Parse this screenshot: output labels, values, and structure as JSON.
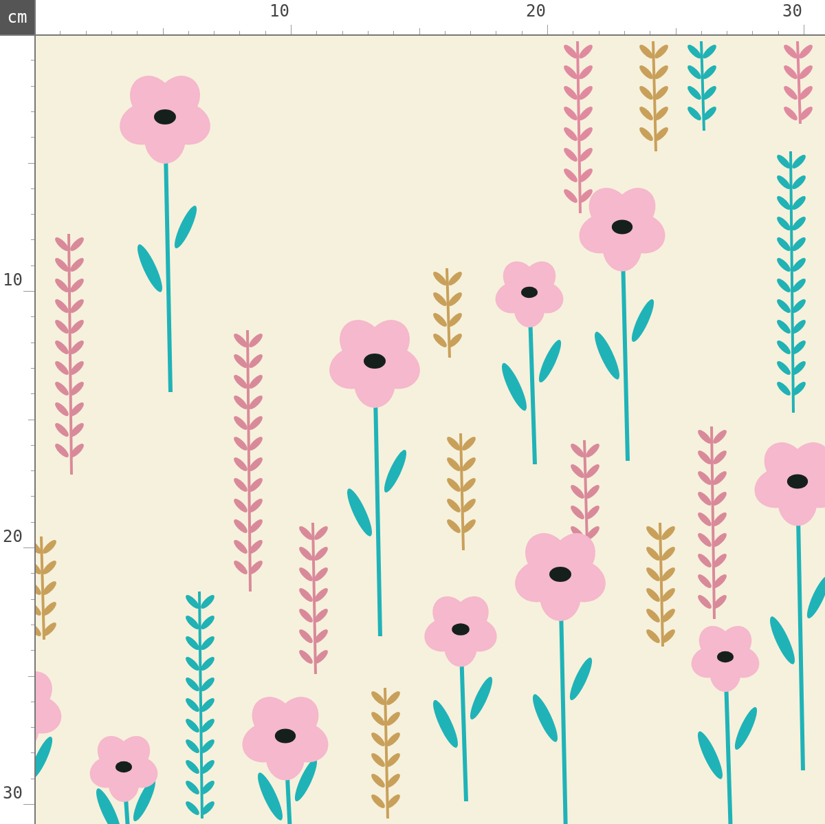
{
  "ruler": {
    "unit": "cm",
    "top_labels": [
      "10",
      "20",
      "30"
    ],
    "left_labels": [
      "10",
      "20",
      "30"
    ]
  }
}
